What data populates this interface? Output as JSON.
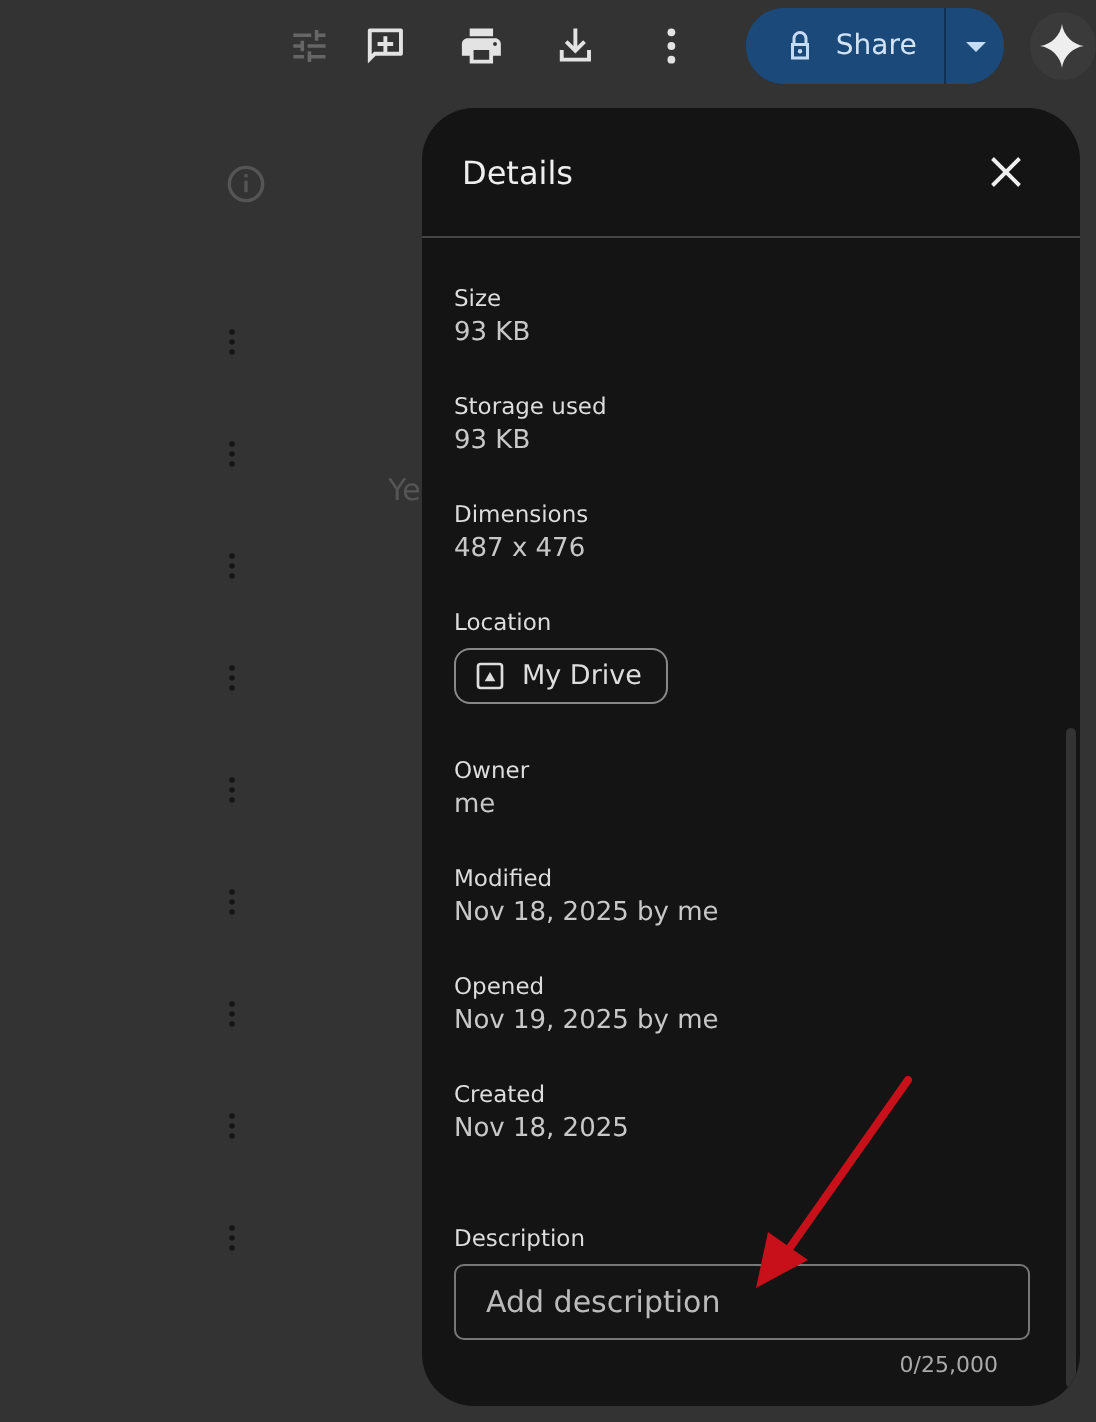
{
  "toolbar": {
    "share_label": "Share"
  },
  "background": {
    "heading": "Ye"
  },
  "details": {
    "title": "Details",
    "fields": [
      {
        "kind": "text",
        "label": "Size",
        "value": "93 KB"
      },
      {
        "kind": "text",
        "label": "Storage used",
        "value": "93 KB"
      },
      {
        "kind": "text",
        "label": "Dimensions",
        "value": "487 x 476"
      },
      {
        "kind": "chip",
        "label": "Location",
        "value": "My Drive"
      },
      {
        "kind": "text",
        "label": "Owner",
        "value": "me"
      },
      {
        "kind": "text",
        "label": "Modified",
        "value": "Nov 18, 2025 by me"
      },
      {
        "kind": "text",
        "label": "Opened",
        "value": "Nov 19, 2025 by me"
      },
      {
        "kind": "text",
        "label": "Created",
        "value": "Nov 18, 2025"
      }
    ],
    "description": {
      "label": "Description",
      "placeholder": "Add description",
      "counter": "0/25,000"
    }
  }
}
